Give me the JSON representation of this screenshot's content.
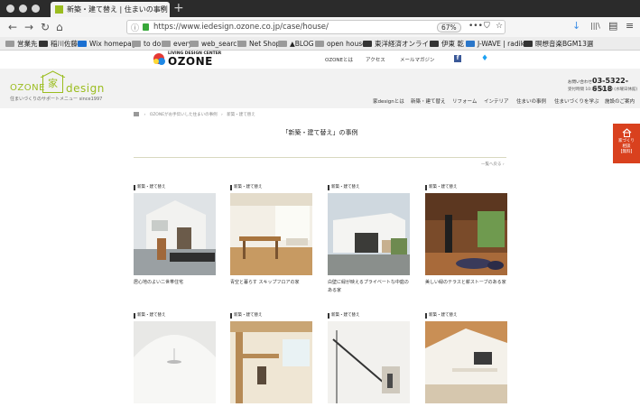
{
  "browser": {
    "tab_title": "新築・建て替え | 住まいの事例 | 家d",
    "tab_close": "×",
    "new_tab": "+",
    "url": "https://www.iedesign.ozone.co.jp/case/house/",
    "zoom": "67%",
    "nav": {
      "back": "←",
      "forward": "→",
      "reload": "↻",
      "home": "⌂"
    },
    "url_icons": {
      "more": "•••",
      "pocket": "⛉",
      "star": "☆"
    },
    "toolbar_icons": {
      "download": "↓",
      "library": "|||\\",
      "sidebar": "▤",
      "menu": "≡"
    }
  },
  "bookmarks": [
    {
      "label": "営業先",
      "icon": "folder-icon"
    },
    {
      "label": "稲川佐藤",
      "icon": "site-icon"
    },
    {
      "label": "Wix homepage",
      "icon": "wix-icon"
    },
    {
      "label": "to do",
      "icon": "folder-icon"
    },
    {
      "label": "every",
      "icon": "folder-icon"
    },
    {
      "label": "web_search",
      "icon": "folder-icon"
    },
    {
      "label": "Net Shop",
      "icon": "folder-icon"
    },
    {
      "label": "▲BLOG",
      "icon": "folder-icon"
    },
    {
      "label": "open house",
      "icon": "folder-icon"
    },
    {
      "label": "東洋経済オンライン",
      "icon": "tk-icon"
    },
    {
      "label": "伊東 乾",
      "icon": "site-icon"
    },
    {
      "label": "J-WAVE | radiko",
      "icon": "site-icon"
    },
    {
      "label": "瞑想音楽BGM13選",
      "icon": "site-icon"
    }
  ],
  "site": {
    "ozone_small": "LIVING DESIGN CENTER",
    "ozone_big": "OZONE",
    "top_links": [
      "OZONEとは",
      "アクセス",
      "メールマガジン"
    ],
    "logo": {
      "ozone": "OZONE",
      "ie": "家",
      "design": "design",
      "tagline": "住まいづくりのサポートメニュー since1997"
    },
    "contact": {
      "label": "お問い合わせ",
      "tel": "03-5322-6518",
      "hours": "受付時間 10:30〜18:00 (水曜日休館)"
    },
    "gnav": [
      "家designとは",
      "新築・建て替え",
      "リフォーム",
      "インテリア",
      "住まいの事例",
      "住まいづくりを学ぶ",
      "施設のご案内"
    ],
    "breadcrumb": [
      "OZONEがお手伝いした住まいの事例",
      "新築・建て替え"
    ],
    "page_title": "「新築・建て替え」の事例",
    "back_link": "一覧へ戻る",
    "side_button": [
      "家づくり",
      "相談",
      "【無料】"
    ]
  },
  "cases": [
    {
      "category": "新築・建て替え",
      "title": "居心地のよい二世帯住宅"
    },
    {
      "category": "新築・建て替え",
      "title": "青空と暮らす スキップフロアの家"
    },
    {
      "category": "新築・建て替え",
      "title": "白壁に緑が映えるプライベートな中庭のある家"
    },
    {
      "category": "新築・建て替え",
      "title": "美しい緑のテラスと薪ストーブのある家"
    },
    {
      "category": "新築・建て替え",
      "title": ""
    },
    {
      "category": "新築・建て替え",
      "title": ""
    },
    {
      "category": "新築・建て替え",
      "title": ""
    },
    {
      "category": "新築・建て替え",
      "title": ""
    }
  ],
  "colors": {
    "brand_green": "#9bbd1f",
    "side_orange": "#d9411e"
  }
}
